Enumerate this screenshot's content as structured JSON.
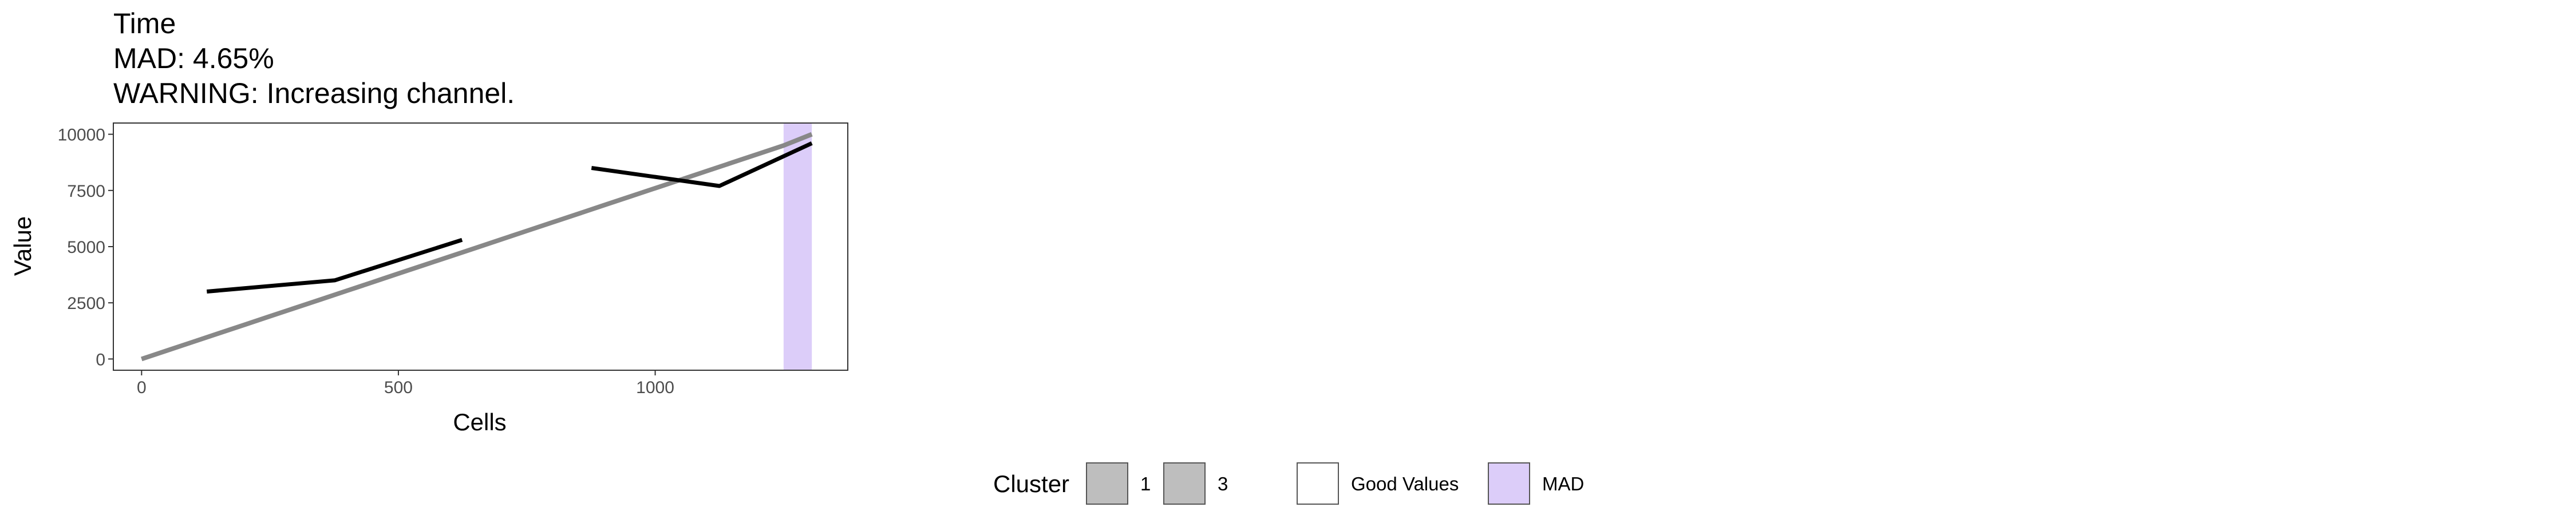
{
  "chart_data": {
    "type": "line",
    "title_lines": [
      "Time",
      "MAD: 4.65%",
      "WARNING: Increasing channel."
    ],
    "xlabel": "Cells",
    "ylabel": "Value",
    "xlim": [
      -55,
      1375
    ],
    "ylim": [
      -500,
      10500
    ],
    "x_ticks": [
      0,
      500,
      1000
    ],
    "y_ticks": [
      0,
      2500,
      5000,
      7500,
      10000
    ],
    "x_tick_labels": [
      "0",
      "500",
      "1000"
    ],
    "y_tick_labels": [
      "0",
      "2500",
      "5000",
      "7500",
      "10000"
    ],
    "grid": false,
    "legend_placement": "bottom",
    "series": [
      {
        "color": "#888888",
        "x": [
          0,
          50,
          100,
          150,
          200,
          250,
          300,
          350,
          400,
          450,
          500,
          550,
          600,
          650,
          700,
          750,
          800,
          850,
          900,
          950,
          1000,
          1050,
          1100,
          1150,
          1200,
          1250,
          1305
        ],
        "y": [
          0,
          380,
          760,
          1140,
          1520,
          1900,
          2280,
          2660,
          3040,
          3420,
          3800,
          4180,
          4560,
          4940,
          5320,
          5700,
          6080,
          6460,
          6840,
          7220,
          7600,
          7980,
          8360,
          8740,
          9120,
          9500,
          10000
        ]
      },
      {
        "color": "#000000",
        "x": [
          127,
          376,
          624
        ],
        "y": [
          3000,
          3500,
          5300
        ]
      },
      {
        "color": "#000000",
        "x": [
          876,
          1125,
          1305
        ],
        "y": [
          8500,
          7700,
          9600
        ]
      }
    ],
    "mad_band": {
      "x": [
        1250,
        1305
      ],
      "color": "#dccdf9"
    },
    "legend": {
      "title": "Cluster",
      "items": [
        {
          "label": "1",
          "fill": "#bebebe"
        },
        {
          "label": "3",
          "fill": "#bebebe"
        },
        {
          "label": "Good Values",
          "fill": "#ffffff"
        },
        {
          "label": "MAD",
          "fill": "#dccdf9"
        }
      ]
    }
  }
}
